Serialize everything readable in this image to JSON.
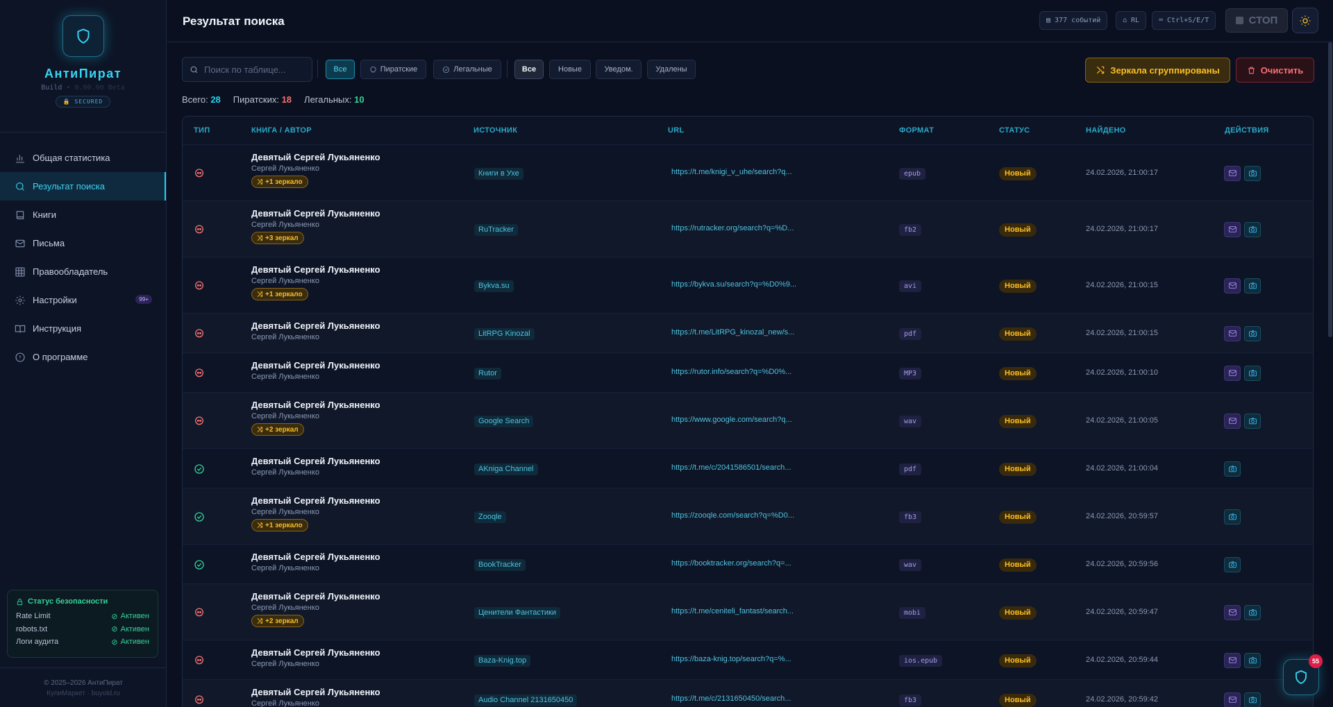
{
  "app": {
    "name": "АнтиПират",
    "build_label": "Build",
    "build_hidden": "• 0.00.00 Beta",
    "secured_label": "SECURED",
    "copyright": "© 2025–2026 АнтиПират",
    "copyright_sub": "КупиМаркет · buyold.ru"
  },
  "colors": {
    "accent": "#22d3ee",
    "pirate": "#f87171",
    "legal": "#34d399",
    "warning": "#fbbf24",
    "mail": "#a78bfa"
  },
  "sidebar": {
    "items": [
      {
        "label": "Общая статистика",
        "icon": "bar-chart-icon"
      },
      {
        "label": "Результат поиска",
        "icon": "search-icon",
        "active": true
      },
      {
        "label": "Книги",
        "icon": "book-icon"
      },
      {
        "label": "Письма",
        "icon": "mail-icon"
      },
      {
        "label": "Правообладатель",
        "icon": "table-icon"
      },
      {
        "label": "Настройки",
        "icon": "gear-icon",
        "badge": "99+"
      },
      {
        "label": "Инструкция",
        "icon": "open-book-icon"
      },
      {
        "label": "О программе",
        "icon": "info-icon"
      }
    ]
  },
  "security": {
    "title": "Статус безопасности",
    "rows": [
      {
        "label": "Rate Limit",
        "value": "Активен"
      },
      {
        "label": "robots.txt",
        "value": "Активен"
      },
      {
        "label": "Логи аудита",
        "value": "Активен"
      }
    ]
  },
  "header": {
    "title": "Результат поиска",
    "events": "377 событий",
    "rl": "RL",
    "shortcut": "Ctrl+S/E/T",
    "stop": "СТОП"
  },
  "filters": {
    "search_placeholder": "Поиск по таблице...",
    "type_all": "Все",
    "type_pirate": "Пиратские",
    "type_legal": "Легальные",
    "status_all": "Все",
    "status_new": "Новые",
    "status_notified": "Уведом.",
    "status_removed": "Удалены",
    "mirrors_button": "Зеркала сгруппированы",
    "clear_button": "Очистить"
  },
  "stats": {
    "total_label": "Всего:",
    "total": "28",
    "pirate_label": "Пиратских:",
    "pirate": "18",
    "legal_label": "Легальных:",
    "legal": "10"
  },
  "table": {
    "headers": [
      "ТИП",
      "КНИГА / АВТОР",
      "ИСТОЧНИК",
      "URL",
      "ФОРМАТ",
      "СТАТУС",
      "НАЙДЕНО",
      "ДЕЙСТВИЯ"
    ],
    "rows": [
      {
        "type": "pirate",
        "title": "Девятый Сергей Лукьяненко",
        "author": "Сергей Лукьяненко",
        "mirror": "+1 зеркало",
        "source": "Книги в Ухе",
        "url": "https://t.me/knigi_v_uhe/search?q...",
        "format": "epub",
        "status": "Новый",
        "found": "24.02.2026, 21:00:17",
        "mail": true
      },
      {
        "type": "pirate",
        "title": "Девятый Сергей Лукьяненко",
        "author": "Сергей Лукьяненко",
        "mirror": "+3 зеркал",
        "source": "RuTracker",
        "url": "https://rutracker.org/search?q=%D...",
        "format": "fb2",
        "status": "Новый",
        "found": "24.02.2026, 21:00:17",
        "mail": true
      },
      {
        "type": "pirate",
        "title": "Девятый Сергей Лукьяненко",
        "author": "Сергей Лукьяненко",
        "mirror": "+1 зеркало",
        "source": "Bykva.su",
        "url": "https://bykva.su/search?q=%D0%9...",
        "format": "avi",
        "status": "Новый",
        "found": "24.02.2026, 21:00:15",
        "mail": true
      },
      {
        "type": "pirate",
        "title": "Девятый Сергей Лукьяненко",
        "author": "Сергей Лукьяненко",
        "mirror": "",
        "source": "LitRPG Kinozal",
        "url": "https://t.me/LitRPG_kinozal_new/s...",
        "format": "pdf",
        "status": "Новый",
        "found": "24.02.2026, 21:00:15",
        "mail": true
      },
      {
        "type": "pirate",
        "title": "Девятый Сергей Лукьяненко",
        "author": "Сергей Лукьяненко",
        "mirror": "",
        "source": "Rutor",
        "url": "https://rutor.info/search?q=%D0%...",
        "format": "MP3",
        "status": "Новый",
        "found": "24.02.2026, 21:00:10",
        "mail": true
      },
      {
        "type": "pirate",
        "title": "Девятый Сергей Лукьяненко",
        "author": "Сергей Лукьяненко",
        "mirror": "+2 зеркал",
        "source": "Google Search",
        "url": "https://www.google.com/search?q...",
        "format": "wav",
        "status": "Новый",
        "found": "24.02.2026, 21:00:05",
        "mail": true
      },
      {
        "type": "legal",
        "title": "Девятый Сергей Лукьяненко",
        "author": "Сергей Лукьяненко",
        "mirror": "",
        "source": "AKniga Channel",
        "url": "https://t.me/c/2041586501/search...",
        "format": "pdf",
        "status": "Новый",
        "found": "24.02.2026, 21:00:04",
        "mail": false
      },
      {
        "type": "legal",
        "title": "Девятый Сергей Лукьяненко",
        "author": "Сергей Лукьяненко",
        "mirror": "+1 зеркало",
        "source": "Zooqle",
        "url": "https://zooqle.com/search?q=%D0...",
        "format": "fb3",
        "status": "Новый",
        "found": "24.02.2026, 20:59:57",
        "mail": false
      },
      {
        "type": "legal",
        "title": "Девятый Сергей Лукьяненко",
        "author": "Сергей Лукьяненко",
        "mirror": "",
        "source": "BookTracker",
        "url": "https://booktracker.org/search?q=...",
        "format": "wav",
        "status": "Новый",
        "found": "24.02.2026, 20:59:56",
        "mail": false
      },
      {
        "type": "pirate",
        "title": "Девятый Сергей Лукьяненко",
        "author": "Сергей Лукьяненко",
        "mirror": "+2 зеркал",
        "source": "Ценители Фантастики",
        "url": "https://t.me/ceniteli_fantast/search...",
        "format": "mobi",
        "status": "Новый",
        "found": "24.02.2026, 20:59:47",
        "mail": true
      },
      {
        "type": "pirate",
        "title": "Девятый Сергей Лукьяненко",
        "author": "Сергей Лукьяненко",
        "mirror": "",
        "source": "Baza-Knig.top",
        "url": "https://baza-knig.top/search?q=%...",
        "format": "ios.epub",
        "status": "Новый",
        "found": "24.02.2026, 20:59:44",
        "mail": true
      },
      {
        "type": "pirate",
        "title": "Девятый Сергей Лукьяненко",
        "author": "Сергей Лукьяненко",
        "mirror": "",
        "source": "Audio Channel 2131650450",
        "url": "https://t.me/c/2131650450/search...",
        "format": "fb3",
        "status": "Новый",
        "found": "24.02.2026, 20:59:42",
        "mail": true
      }
    ]
  },
  "fab": {
    "badge": "55"
  }
}
